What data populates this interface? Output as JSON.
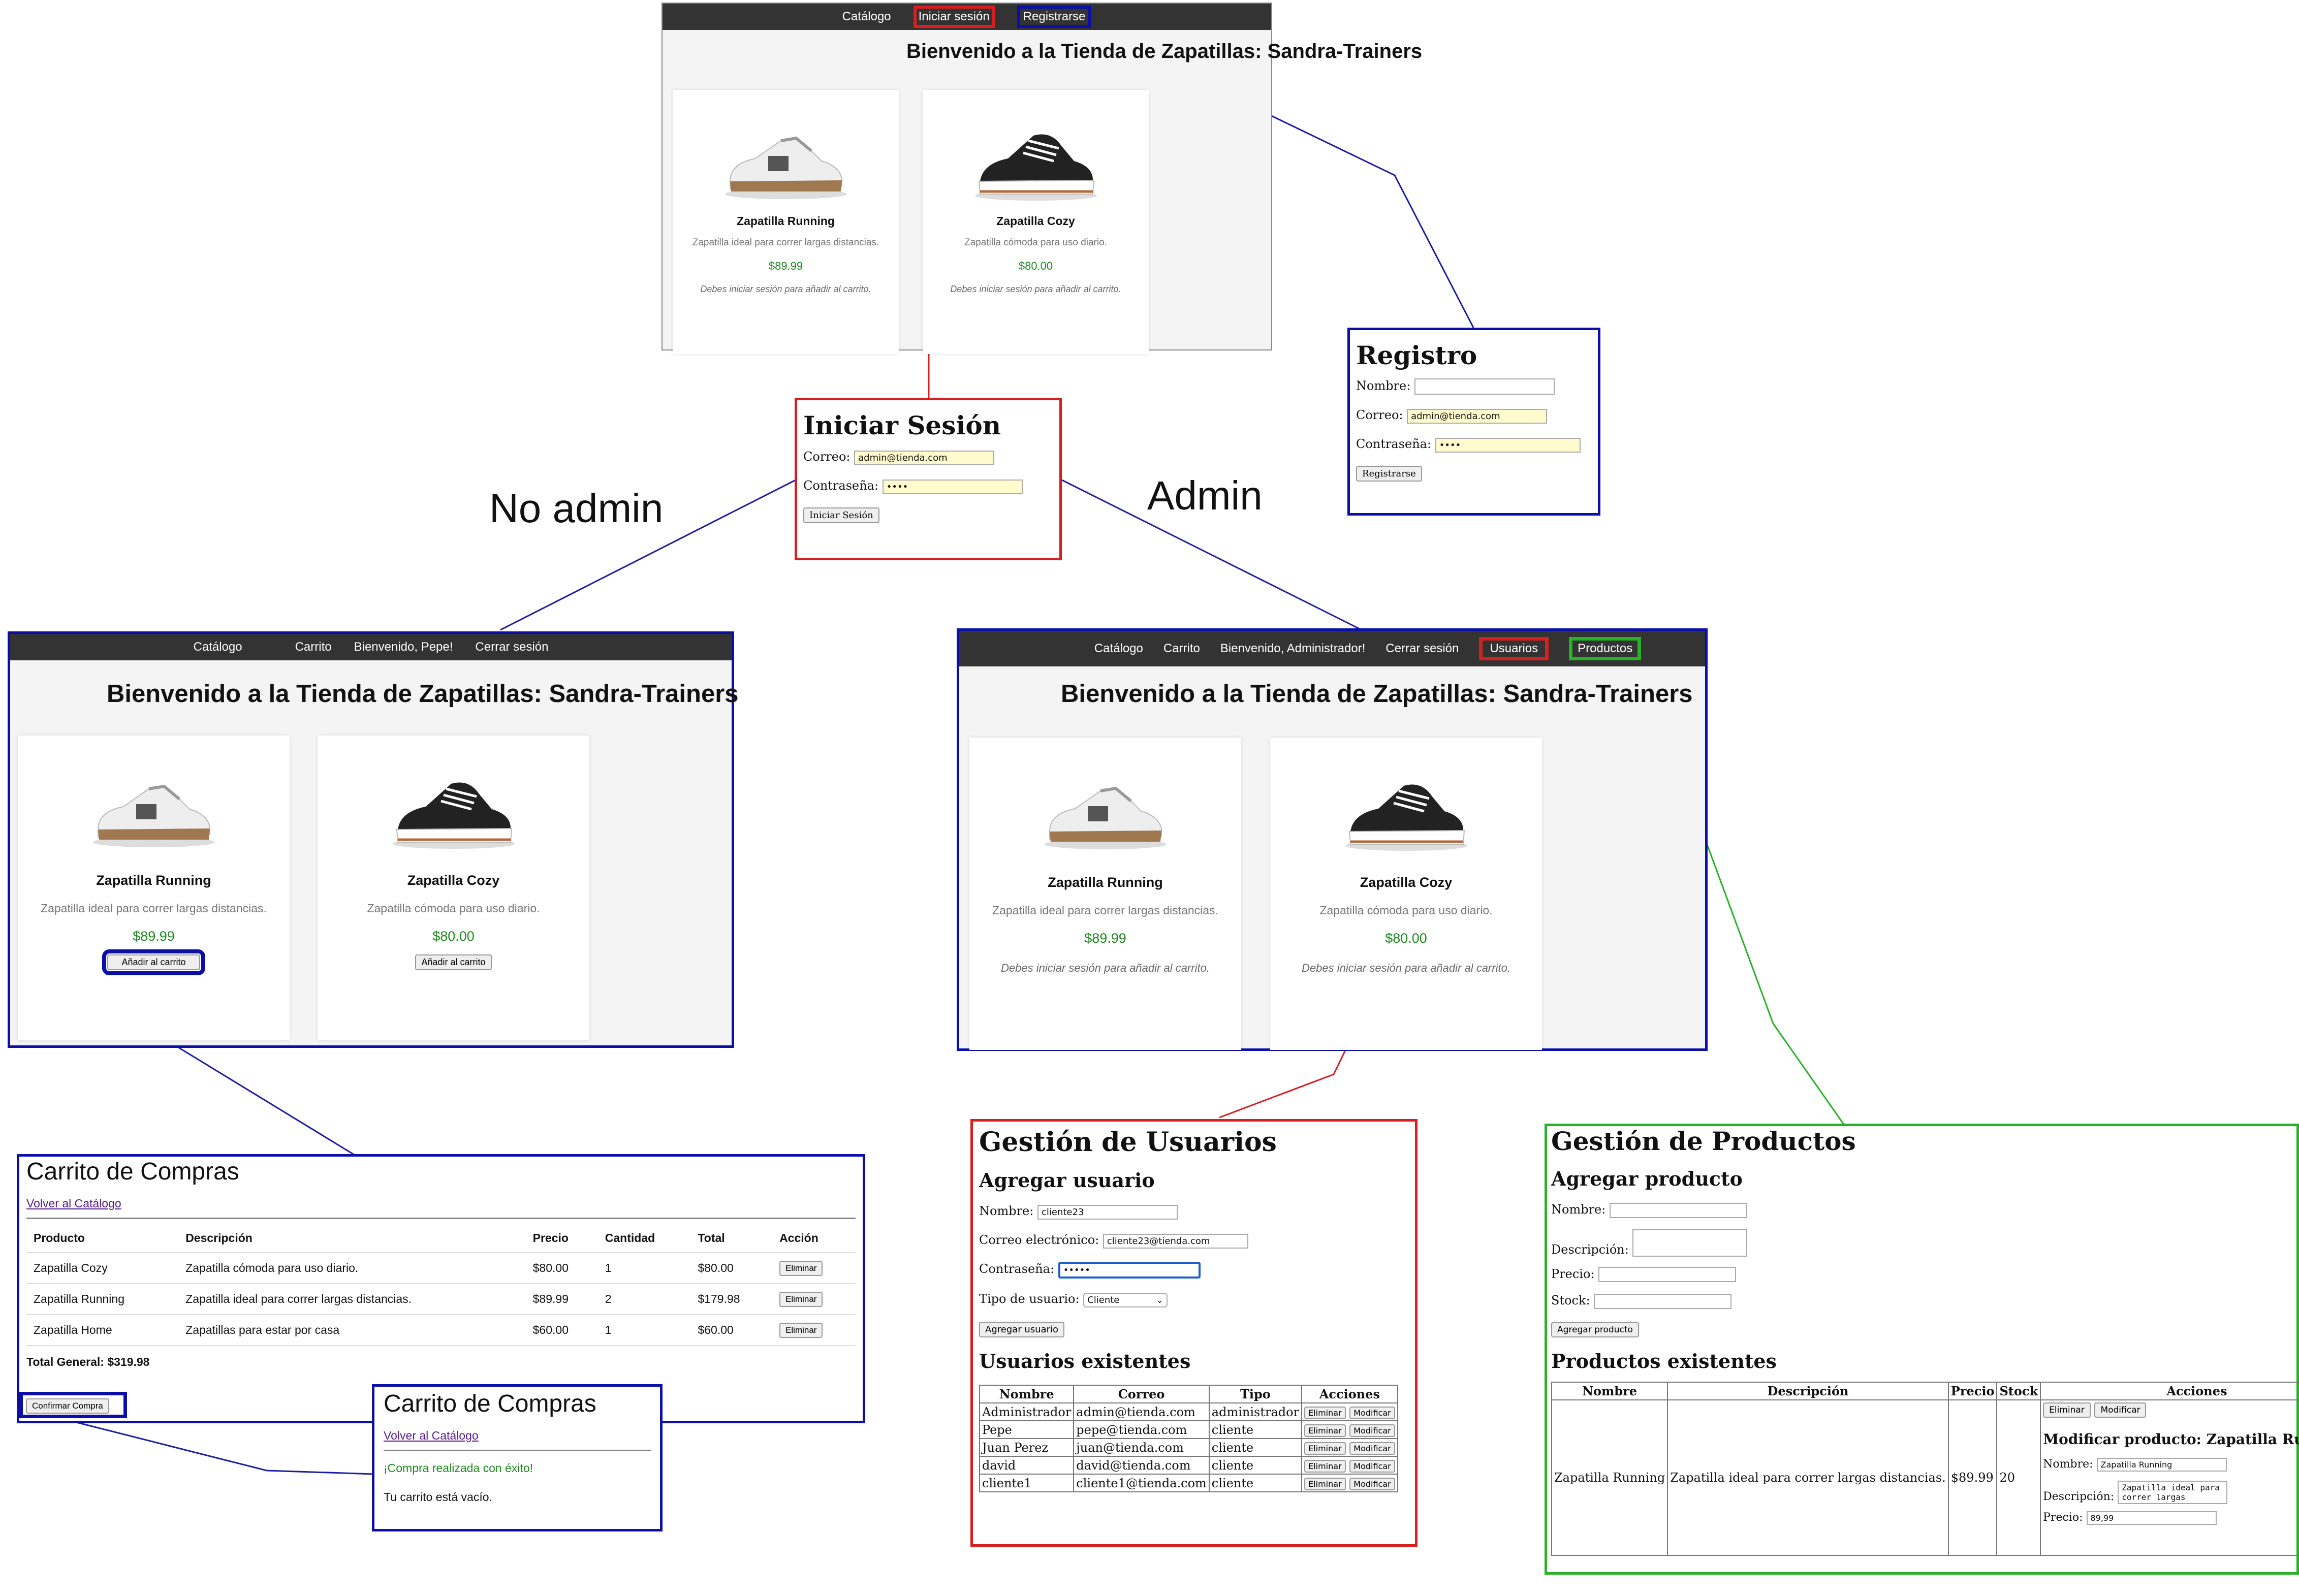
{
  "labels": {
    "no_admin": "No admin",
    "admin": "Admin"
  },
  "top_shop": {
    "nav": [
      "Catálogo",
      "Iniciar sesión",
      "Registrarse"
    ],
    "title": "Bienvenido a la Tienda de Zapatillas: Sandra-Trainers",
    "products": [
      {
        "name": "Zapatilla Running",
        "desc": "Zapatilla ideal para correr largas distancias.",
        "price": "$89.99",
        "note": "Debes iniciar sesión para añadir al carrito."
      },
      {
        "name": "Zapatilla Cozy",
        "desc": "Zapatilla cómoda para uso diario.",
        "price": "$80.00",
        "note": "Debes iniciar sesión para añadir al carrito."
      }
    ]
  },
  "register": {
    "title": "Registro",
    "name_label": "Nombre:",
    "name_value": "",
    "email_label": "Correo:",
    "email_value": "admin@tienda.com",
    "password_label": "Contraseña:",
    "password_value": "••••",
    "button": "Registrarse"
  },
  "login": {
    "title": "Iniciar Sesión",
    "email_label": "Correo:",
    "email_value": "admin@tienda.com",
    "password_label": "Contraseña:",
    "password_value": "••••",
    "button": "Iniciar Sesión"
  },
  "user_shop": {
    "nav": [
      "Catálogo",
      "Carrito",
      "Bienvenido, Pepe!",
      "Cerrar sesión"
    ],
    "title": "Bienvenido a la Tienda de Zapatillas: Sandra-Trainers",
    "products": [
      {
        "name": "Zapatilla Running",
        "desc": "Zapatilla ideal para correr largas distancias.",
        "price": "$89.99",
        "button": "Añadir al carrito"
      },
      {
        "name": "Zapatilla Cozy",
        "desc": "Zapatilla cómoda para uso diario.",
        "price": "$80.00",
        "button": "Añadir al carrito"
      }
    ]
  },
  "admin_shop": {
    "nav": [
      "Catálogo",
      "Carrito",
      "Bienvenido, Administrador!",
      "Cerrar sesión",
      "Usuarios",
      "Productos"
    ],
    "title": "Bienvenido a la Tienda de Zapatillas: Sandra-Trainers",
    "products": [
      {
        "name": "Zapatilla Running",
        "desc": "Zapatilla ideal para correr largas distancias.",
        "price": "$89.99",
        "note": "Debes iniciar sesión para añadir al carrito."
      },
      {
        "name": "Zapatilla Cozy",
        "desc": "Zapatilla cómoda para uso diario.",
        "price": "$80.00",
        "note": "Debes iniciar sesión para añadir al carrito."
      }
    ]
  },
  "cart": {
    "title": "Carrito de Compras",
    "back_link": "Volver al Catálogo",
    "headers": [
      "Producto",
      "Descripción",
      "Precio",
      "Cantidad",
      "Total",
      "Acción"
    ],
    "rows": [
      [
        "Zapatilla Cozy",
        "Zapatilla cómoda para uso diario.",
        "$80.00",
        "1",
        "$80.00",
        "Eliminar"
      ],
      [
        "Zapatilla Running",
        "Zapatilla ideal para correr largas distancias.",
        "$89.99",
        "2",
        "$179.98",
        "Eliminar"
      ],
      [
        "Zapatilla Home",
        "Zapatillas para estar por casa",
        "$60.00",
        "1",
        "$60.00",
        "Eliminar"
      ]
    ],
    "total": "Total General: $319.98",
    "confirm": "Confirmar Compra"
  },
  "cart_done": {
    "title": "Carrito de Compras",
    "back_link": "Volver al Catálogo",
    "success": "¡Compra realizada con éxito!",
    "empty": "Tu carrito está vacío."
  },
  "users": {
    "title": "Gestión de Usuarios",
    "add_title": "Agregar usuario",
    "name_label": "Nombre:",
    "name_value": "cliente23",
    "email_label": "Correo electrónico:",
    "email_value": "cliente23@tienda.com",
    "password_label": "Contraseña:",
    "password_value": "•••••",
    "type_label": "Tipo de usuario:",
    "type_value": "Cliente",
    "add_button": "Agregar usuario",
    "list_title": "Usuarios existentes",
    "headers": [
      "Nombre",
      "Correo",
      "Tipo",
      "Acciones"
    ],
    "rows": [
      [
        "Administrador",
        "admin@tienda.com",
        "administrador"
      ],
      [
        "Pepe",
        "pepe@tienda.com",
        "cliente"
      ],
      [
        "Juan Perez",
        "juan@tienda.com",
        "cliente"
      ],
      [
        "david",
        "david@tienda.com",
        "cliente"
      ],
      [
        "cliente1",
        "cliente1@tienda.com",
        "cliente"
      ]
    ],
    "delete": "Eliminar",
    "modify": "Modificar"
  },
  "products": {
    "title": "Gestión de Productos",
    "add_title": "Agregar producto",
    "name_label": "Nombre:",
    "desc_label": "Descripción:",
    "price_label": "Precio:",
    "stock_label": "Stock:",
    "add_button": "Agregar producto",
    "list_title": "Productos existentes",
    "headers": [
      "Nombre",
      "Descripción",
      "Precio",
      "Stock",
      "Acciones"
    ],
    "row": [
      "Zapatilla Running",
      "Zapatilla ideal para correr largas distancias.",
      "$89.99",
      "20"
    ],
    "delete": "Eliminar",
    "modify": "Modificar",
    "edit_title": "Modificar producto: Zapatilla Running",
    "edit_name_value": "Zapatilla Running",
    "edit_desc_value": "Zapatilla ideal para correr largas",
    "edit_price_value": "89,99"
  },
  "colors": {
    "blue": "#0b0fa7",
    "red": "#d81f1f",
    "green": "#27b227",
    "nav": "#333333",
    "price": "#1e8a1e"
  }
}
